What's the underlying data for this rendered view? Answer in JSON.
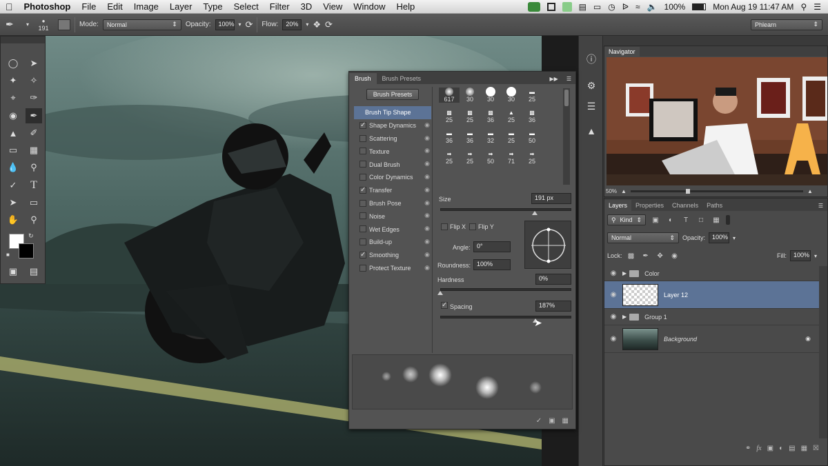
{
  "menubar": {
    "app": "Photoshop",
    "items": [
      "File",
      "Edit",
      "Image",
      "Layer",
      "Type",
      "Select",
      "Filter",
      "3D",
      "View",
      "Window",
      "Help"
    ],
    "battery": "100%",
    "clock": "Mon Aug 19  11:47 AM"
  },
  "options": {
    "brush_size": "191",
    "mode_label": "Mode:",
    "mode_value": "Normal",
    "opacity_label": "Opacity:",
    "opacity_value": "100%",
    "flow_label": "Flow:",
    "flow_value": "20%",
    "workspace": "Phlearn"
  },
  "brush_panel": {
    "tabs": [
      "Brush",
      "Brush Presets"
    ],
    "presets_button": "Brush Presets",
    "options": [
      {
        "label": "Brush Tip Shape",
        "checked": false,
        "selected": true
      },
      {
        "label": "Shape Dynamics",
        "checked": true
      },
      {
        "label": "Scattering",
        "checked": false
      },
      {
        "label": "Texture",
        "checked": false
      },
      {
        "label": "Dual Brush",
        "checked": false
      },
      {
        "label": "Color Dynamics",
        "checked": false
      },
      {
        "label": "Transfer",
        "checked": true
      },
      {
        "label": "Brush Pose",
        "checked": false
      },
      {
        "label": "Noise",
        "checked": false
      },
      {
        "label": "Wet Edges",
        "checked": false
      },
      {
        "label": "Build-up",
        "checked": false
      },
      {
        "label": "Smoothing",
        "checked": true
      },
      {
        "label": "Protect Texture",
        "checked": false
      }
    ],
    "tip_sizes": [
      [
        "617",
        "30",
        "30",
        "30",
        "25"
      ],
      [
        "25",
        "25",
        "36",
        "25",
        "36"
      ],
      [
        "36",
        "36",
        "32",
        "25",
        "50"
      ],
      [
        "25",
        "25",
        "50",
        "71",
        "25"
      ]
    ],
    "size_label": "Size",
    "size_value": "191 px",
    "flip_x": "Flip X",
    "flip_y": "Flip Y",
    "angle_label": "Angle:",
    "angle_value": "0°",
    "roundness_label": "Roundness:",
    "roundness_value": "100%",
    "hardness_label": "Hardness",
    "hardness_value": "0%",
    "spacing_label": "Spacing",
    "spacing_value": "187%"
  },
  "navigator": {
    "tab": "Navigator",
    "zoom": "50%"
  },
  "layers_panel": {
    "tabs": [
      "Layers",
      "Properties",
      "Channels",
      "Paths"
    ],
    "filter": "Kind",
    "blend_mode": "Normal",
    "opacity_label": "Opacity:",
    "opacity_value": "100%",
    "lock_label": "Lock:",
    "fill_label": "Fill:",
    "fill_value": "100%",
    "layers": [
      {
        "name": "Color",
        "type": "group"
      },
      {
        "name": "Layer 12",
        "type": "layer",
        "selected": true
      },
      {
        "name": "Group 1",
        "type": "group"
      },
      {
        "name": "Background",
        "type": "background"
      }
    ]
  },
  "colors": {
    "selection": "#5c7396",
    "panel": "#535353"
  }
}
